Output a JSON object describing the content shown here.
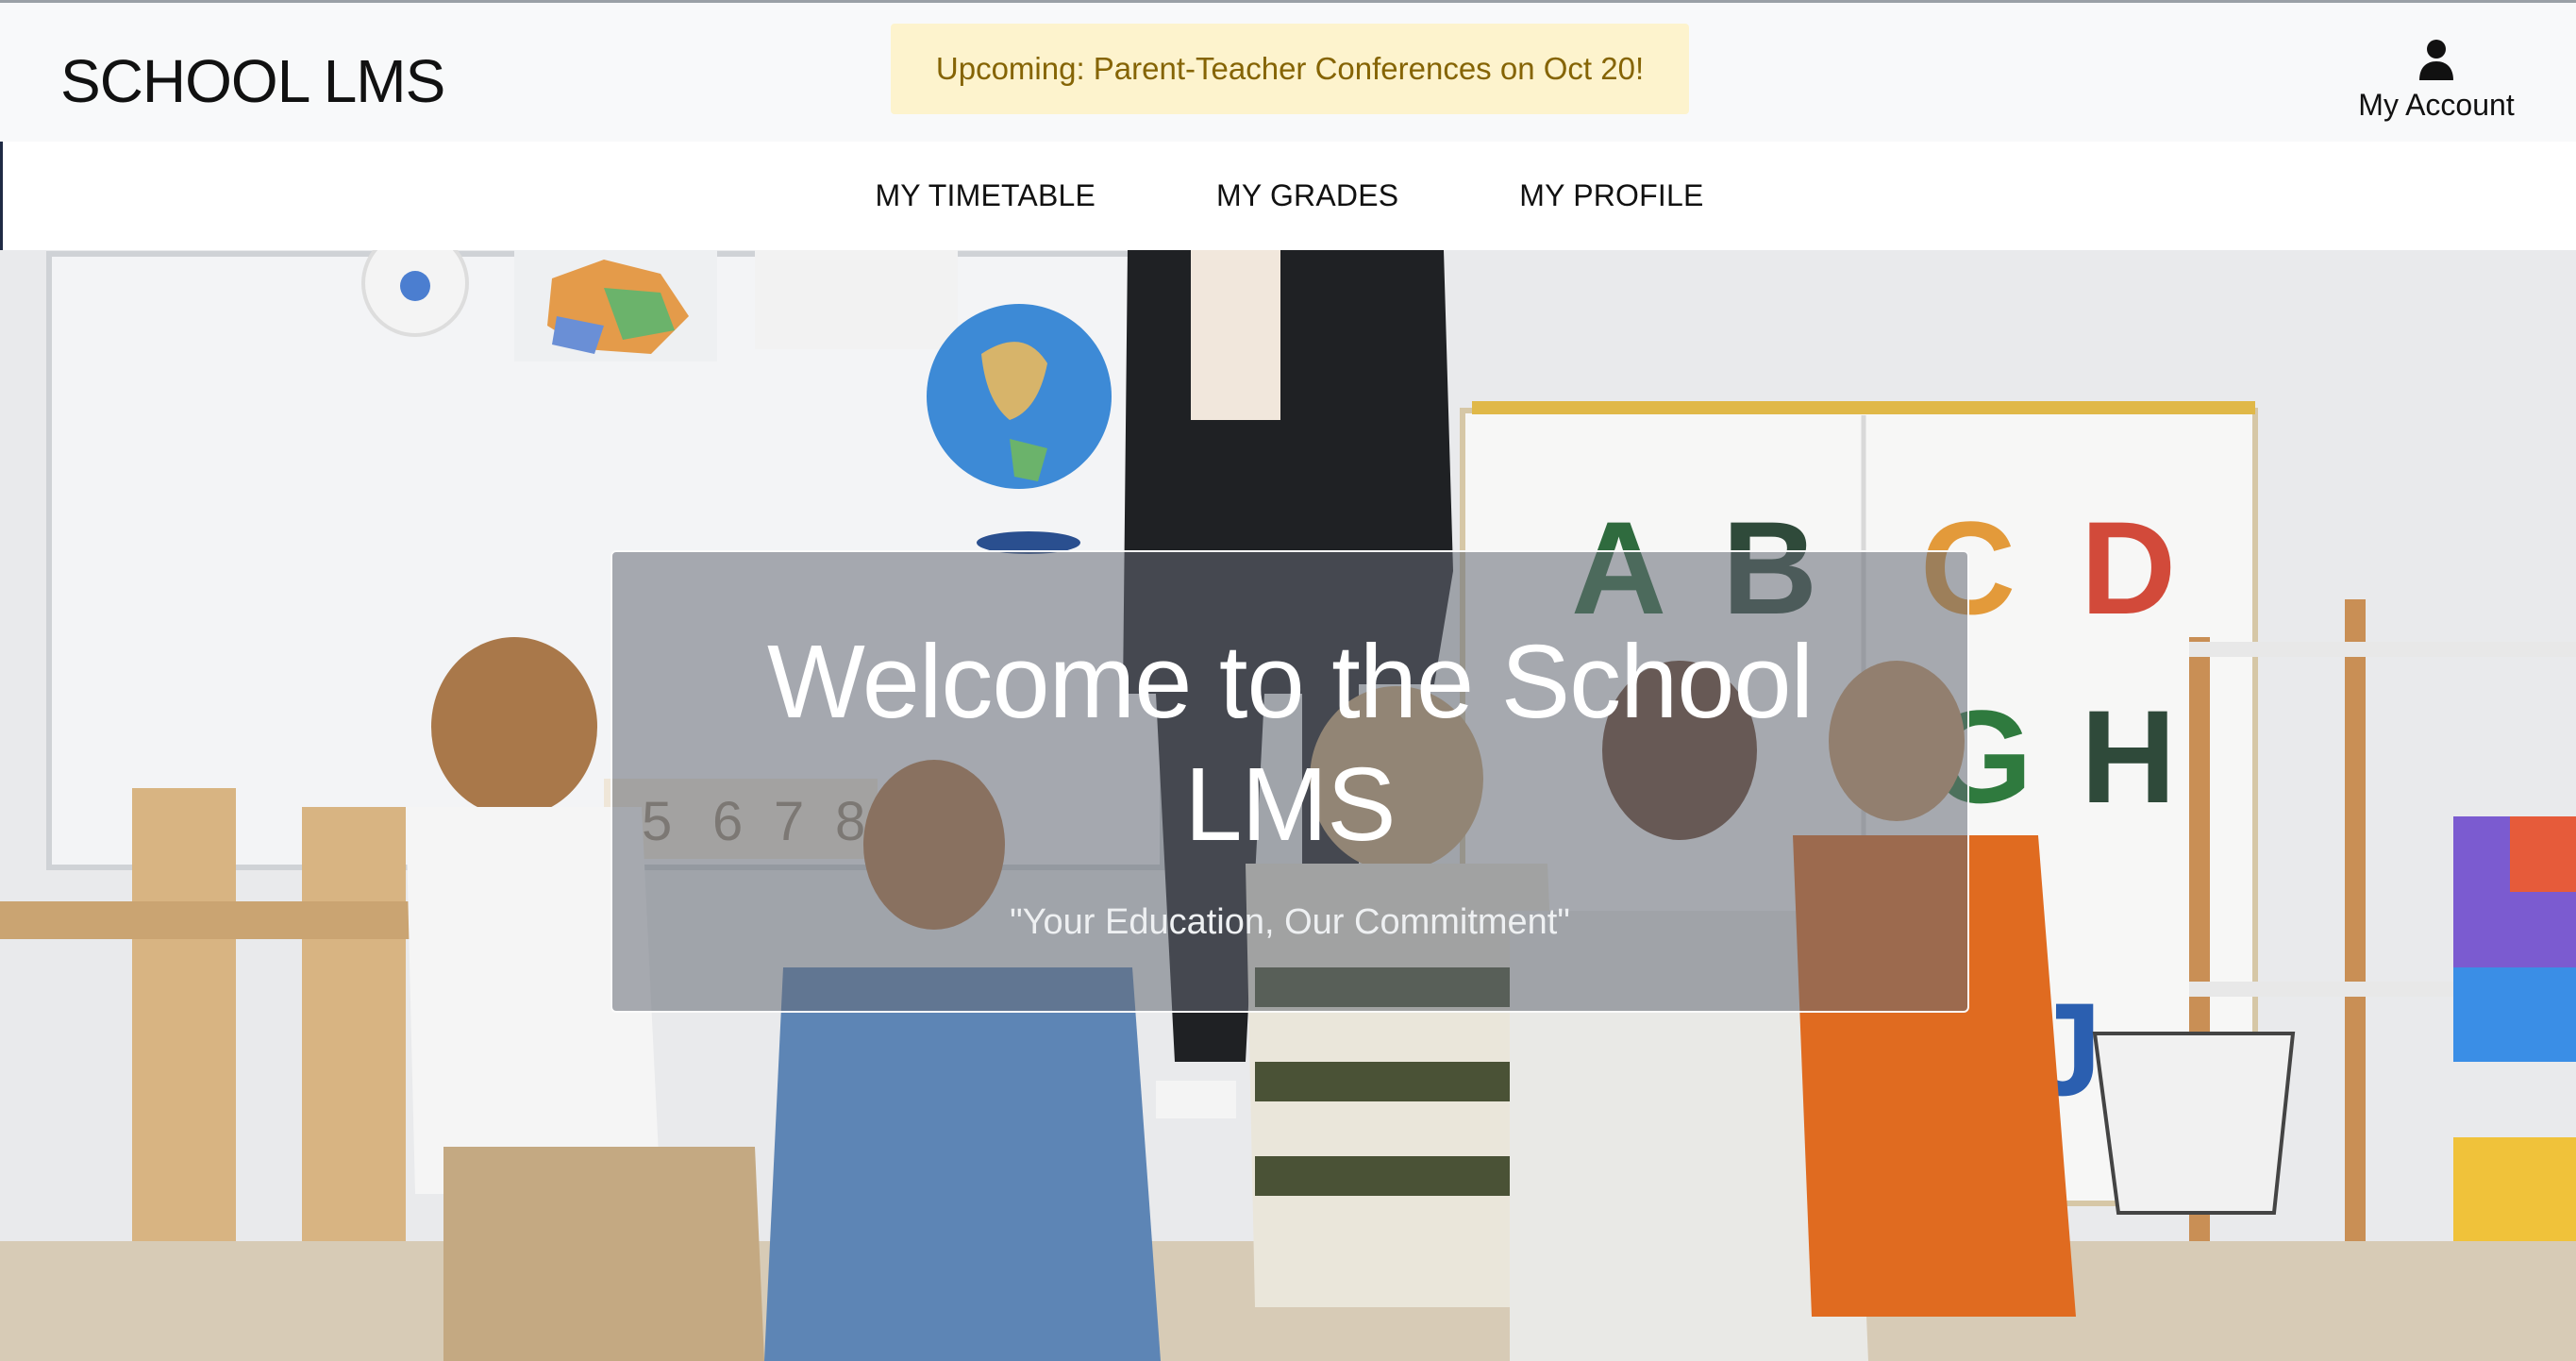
{
  "header": {
    "brand": "SCHOOL LMS",
    "announcement": "Upcoming: Parent-Teacher Conferences on Oct 20!",
    "account": {
      "icon": "user-icon",
      "label": "My Account"
    }
  },
  "nav": {
    "items": [
      {
        "label": "MY TIMETABLE"
      },
      {
        "label": "MY GRADES"
      },
      {
        "label": "MY PROFILE"
      }
    ]
  },
  "hero": {
    "title": "Welcome to the School LMS",
    "tagline": "\"Your Education, Our Commitment\"",
    "board_letters": [
      "A",
      "B",
      "C",
      "D",
      "G",
      "H",
      "J"
    ],
    "board_numbers": [
      "5",
      "6",
      "7",
      "8"
    ]
  },
  "colors": {
    "header_bg": "#f8f9fa",
    "announcement_bg": "#fdf3cd",
    "announcement_text": "#856404",
    "hero_overlay": "rgba(100,106,116,0.55)"
  }
}
